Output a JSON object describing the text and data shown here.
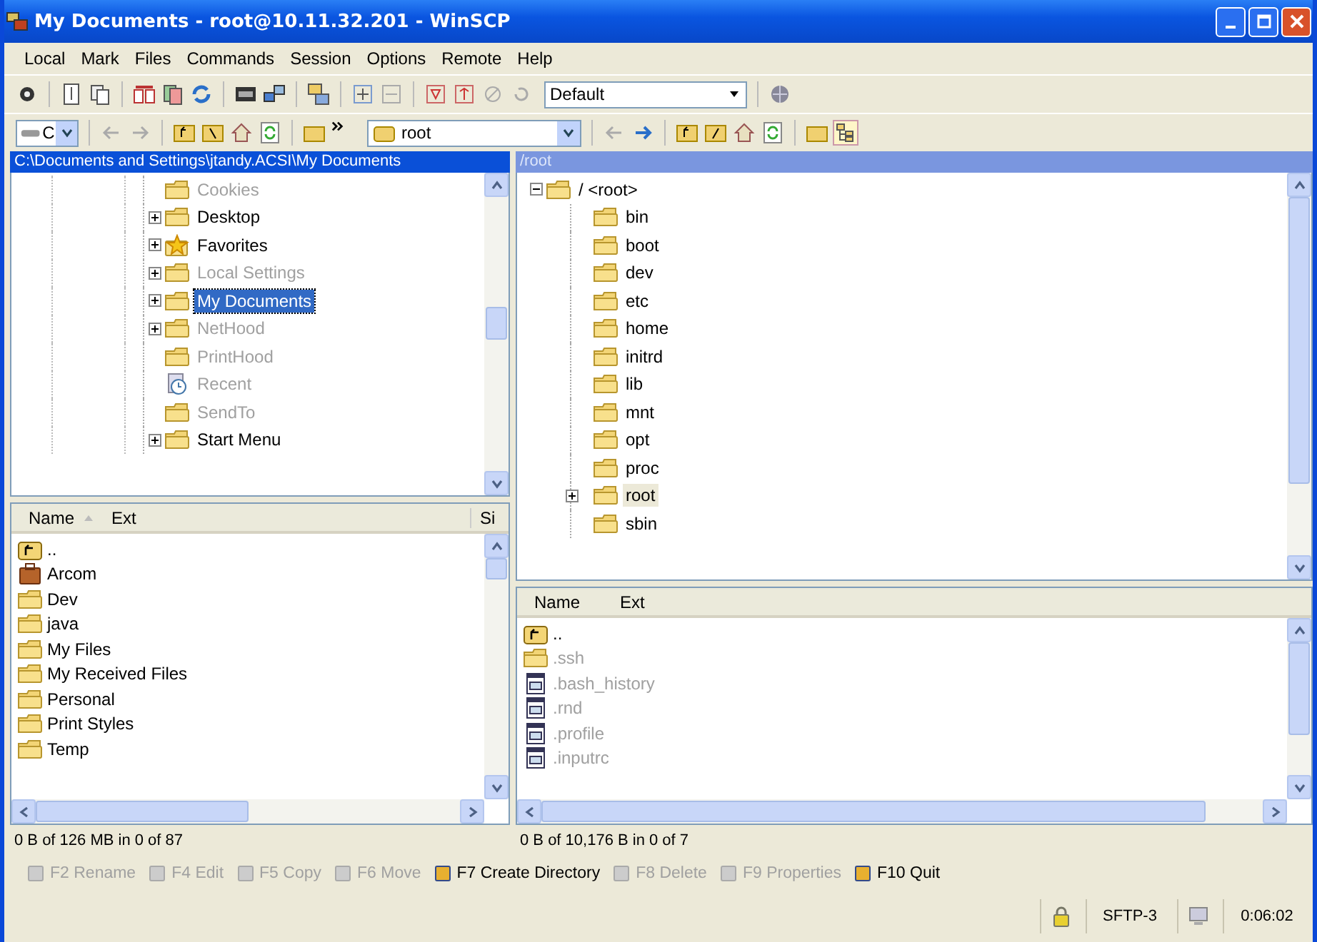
{
  "window": {
    "title": "My Documents - root@10.11.32.201 - WinSCP"
  },
  "menu": [
    {
      "label": "Local"
    },
    {
      "label": "Mark"
    },
    {
      "label": "Files"
    },
    {
      "label": "Commands"
    },
    {
      "label": "Session"
    },
    {
      "label": "Options"
    },
    {
      "label": "Remote"
    },
    {
      "label": "Help"
    }
  ],
  "toolbar": {
    "preset": "Default"
  },
  "left_nav": {
    "drive": "C"
  },
  "right_nav": {
    "folder": "root"
  },
  "left_panel": {
    "path": "C:\\Documents and Settings\\jtandy.ACSI\\My Documents",
    "tree": [
      {
        "label": "Cookies",
        "kind": "folder",
        "expandable": false,
        "disabled": true,
        "selected": false
      },
      {
        "label": "Desktop",
        "kind": "folder",
        "expandable": true,
        "disabled": false,
        "selected": false
      },
      {
        "label": "Favorites",
        "kind": "star",
        "expandable": true,
        "disabled": false,
        "selected": false
      },
      {
        "label": "Local Settings",
        "kind": "folder",
        "expandable": true,
        "disabled": true,
        "selected": false
      },
      {
        "label": "My Documents",
        "kind": "folder",
        "expandable": true,
        "disabled": false,
        "selected": true
      },
      {
        "label": "NetHood",
        "kind": "folder",
        "expandable": true,
        "disabled": true,
        "selected": false
      },
      {
        "label": "PrintHood",
        "kind": "folder",
        "expandable": false,
        "disabled": true,
        "selected": false
      },
      {
        "label": "Recent",
        "kind": "recent",
        "expandable": false,
        "disabled": true,
        "selected": false
      },
      {
        "label": "SendTo",
        "kind": "folder",
        "expandable": false,
        "disabled": true,
        "selected": false
      },
      {
        "label": "Start Menu",
        "kind": "folder",
        "expandable": true,
        "disabled": false,
        "selected": false
      }
    ],
    "columns": [
      "Name",
      "Ext",
      "Si"
    ],
    "files": [
      {
        "name": "..",
        "kind": "up"
      },
      {
        "name": "Arcom",
        "kind": "package"
      },
      {
        "name": "Dev",
        "kind": "folder"
      },
      {
        "name": "java",
        "kind": "folder"
      },
      {
        "name": "My Files",
        "kind": "folder"
      },
      {
        "name": "My Received Files",
        "kind": "folder"
      },
      {
        "name": "Personal",
        "kind": "folder"
      },
      {
        "name": "Print Styles",
        "kind": "folder"
      },
      {
        "name": "Temp",
        "kind": "folder"
      }
    ],
    "summary": "0 B of 126 MB in 0 of 87"
  },
  "right_panel": {
    "path": "/root",
    "tree": {
      "label": "/ <root>",
      "expanded": true,
      "children": [
        {
          "label": "bin",
          "expandable": false,
          "selected": false
        },
        {
          "label": "boot",
          "expandable": false,
          "selected": false
        },
        {
          "label": "dev",
          "expandable": false,
          "selected": false
        },
        {
          "label": "etc",
          "expandable": false,
          "selected": false
        },
        {
          "label": "home",
          "expandable": false,
          "selected": false
        },
        {
          "label": "initrd",
          "expandable": false,
          "selected": false
        },
        {
          "label": "lib",
          "expandable": false,
          "selected": false
        },
        {
          "label": "mnt",
          "expandable": false,
          "selected": false
        },
        {
          "label": "opt",
          "expandable": false,
          "selected": false
        },
        {
          "label": "proc",
          "expandable": false,
          "selected": false
        },
        {
          "label": "root",
          "expandable": true,
          "selected": true
        },
        {
          "label": "sbin",
          "expandable": false,
          "selected": false
        }
      ]
    },
    "columns": [
      "Name",
      "Ext"
    ],
    "files": [
      {
        "name": "..",
        "kind": "up",
        "disabled": false
      },
      {
        "name": ".ssh",
        "kind": "folder",
        "disabled": true
      },
      {
        "name": ".bash_history",
        "kind": "file",
        "disabled": true
      },
      {
        "name": ".rnd",
        "kind": "file",
        "disabled": true
      },
      {
        "name": ".profile",
        "kind": "file",
        "disabled": true
      },
      {
        "name": ".inputrc",
        "kind": "file",
        "disabled": true
      }
    ],
    "summary": "0 B of 10,176 B in 0 of 7"
  },
  "function_keys": [
    {
      "label": "F2 Rename",
      "disabled": true
    },
    {
      "label": "F4 Edit",
      "disabled": true
    },
    {
      "label": "F5 Copy",
      "disabled": true
    },
    {
      "label": "F6 Move",
      "disabled": true
    },
    {
      "label": "F7 Create Directory",
      "disabled": false
    },
    {
      "label": "F8 Delete",
      "disabled": true
    },
    {
      "label": "F9 Properties",
      "disabled": true
    },
    {
      "label": "F10 Quit",
      "disabled": false
    }
  ],
  "status_bar": {
    "protocol": "SFTP-3",
    "elapsed": "0:06:02"
  }
}
